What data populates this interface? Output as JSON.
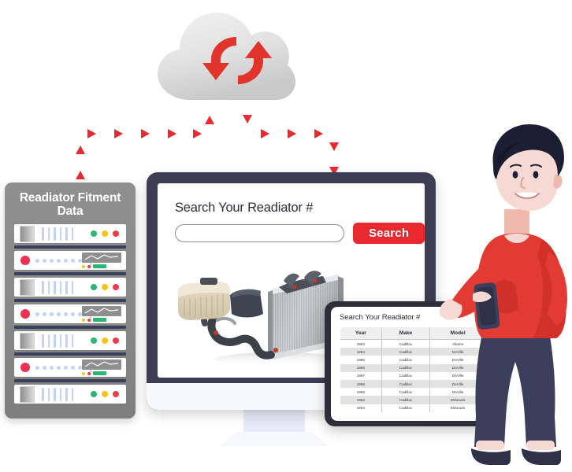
{
  "scene": {
    "title": "Radiator fitment data cloud sync illustration",
    "colors": {
      "accent_red": "#e8292f",
      "cloud_arrow_red": "#e0342c",
      "bezel_navy": "#3c3c54",
      "rack_gray": "#8a8a8a",
      "sweater_red": "#e23b33",
      "trousers_navy": "#3b3f5c",
      "line_white": "#ffffff",
      "led_green": "#2bb673",
      "led_yellow": "#f5c518",
      "led_red": "#ee3b4b"
    }
  },
  "cloud": {
    "icon": "cloud-sync-icon",
    "arrow_down": "sync-arrow-down-icon",
    "arrow_up": "sync-arrow-up-icon"
  },
  "connectors": {
    "left_branch": "data-flow-left-arrows",
    "right_branch": "data-flow-right-arrows",
    "arrow_count_left": 7,
    "arrow_count_right": 6
  },
  "rack": {
    "title": "Readiator Fitment Data",
    "rows": [
      {
        "type": "A",
        "leds": [
          "green",
          "yellow",
          "red"
        ],
        "bars": 6
      },
      {
        "type": "B",
        "dots": 8,
        "chart": "waveform",
        "mini": [
          "yellow",
          "red",
          "green-bar"
        ]
      },
      {
        "type": "A",
        "leds": [
          "green",
          "yellow",
          "red"
        ],
        "bars": 6
      },
      {
        "type": "B",
        "dots": 8,
        "chart": "waveform",
        "mini": [
          "yellow",
          "red",
          "green-bar"
        ]
      },
      {
        "type": "A",
        "leds": [
          "green",
          "yellow",
          "red"
        ],
        "bars": 6
      },
      {
        "type": "B",
        "dots": 8,
        "chart": "waveform",
        "mini": [
          "yellow",
          "red",
          "green-bar"
        ]
      },
      {
        "type": "A",
        "leds": [
          "green",
          "yellow",
          "red"
        ],
        "bars": 6
      }
    ]
  },
  "monitor": {
    "screen_title": "Search Your Readiator #",
    "search_value": "",
    "search_placeholder": "",
    "search_button": "Search",
    "product_image": "car-radiator-photo",
    "power_button": "monitor-power-dot"
  },
  "tablet": {
    "title": "Search Your Readiator #",
    "columns": [
      "Year",
      "Make",
      "Model"
    ],
    "rows": [
      [
        "1993",
        "Cadillac",
        "Allante"
      ],
      [
        "1994",
        "Cadillac",
        "DeVille"
      ],
      [
        "1995",
        "Cadillac",
        "DeVille"
      ],
      [
        "1996",
        "Cadillac",
        "DeVille"
      ],
      [
        "1997",
        "Cadillac",
        "DeVille"
      ],
      [
        "1998",
        "Cadillac",
        "DeVille"
      ],
      [
        "1999",
        "Cadillac",
        "DeVille"
      ],
      [
        "1993",
        "Cadillac",
        "Eldorado"
      ],
      [
        "1994",
        "Cadillac",
        "Eldorado"
      ]
    ]
  },
  "person": {
    "description": "man-pointing-illustration",
    "holding": "smartphone-icon"
  }
}
